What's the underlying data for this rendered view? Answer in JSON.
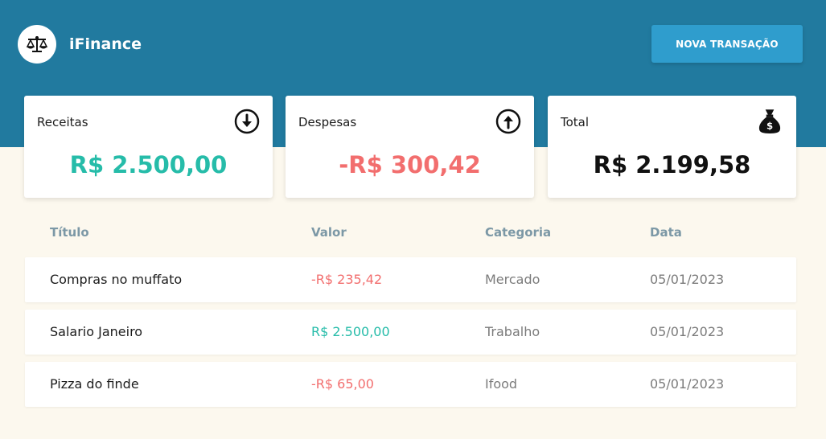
{
  "app": {
    "name": "iFinance",
    "logo_icon": "scale-icon"
  },
  "header": {
    "new_transaction_label": "NOVA TRANSAÇÃO"
  },
  "summary": {
    "income": {
      "label": "Receitas",
      "value": "R$ 2.500,00",
      "icon": "arrow-down-circle-icon",
      "color": "#26bca9"
    },
    "expenses": {
      "label": "Despesas",
      "value": "-R$ 300,42",
      "icon": "arrow-up-circle-icon",
      "color": "#f26e6e"
    },
    "total": {
      "label": "Total",
      "value": "R$ 2.199,58",
      "icon": "money-bag-icon",
      "color": "#111111"
    }
  },
  "table": {
    "columns": [
      "Título",
      "Valor",
      "Categoria",
      "Data"
    ],
    "rows": [
      {
        "title": "Compras no muffato",
        "value": "-R$ 235,42",
        "type": "expense",
        "category": "Mercado",
        "date": "05/01/2023"
      },
      {
        "title": "Salario Janeiro",
        "value": "R$ 2.500,00",
        "type": "income",
        "category": "Trabalho",
        "date": "05/01/2023"
      },
      {
        "title": "Pizza do finde",
        "value": "-R$ 65,00",
        "type": "expense",
        "category": "Ifood",
        "date": "05/01/2023"
      }
    ]
  },
  "colors": {
    "header_bg": "#217a9f",
    "button_bg": "#2f9dcd",
    "page_bg": "#fcf8ee",
    "income": "#26bca9",
    "expense": "#f26e6e"
  }
}
